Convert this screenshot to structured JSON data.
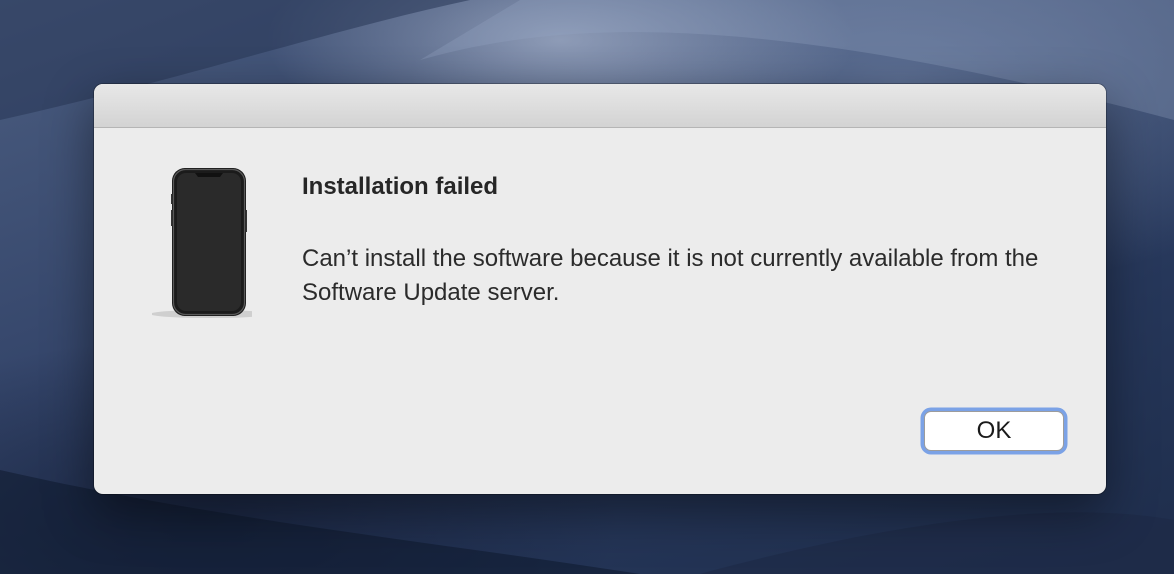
{
  "dialog": {
    "title": "Installation failed",
    "message": "Can’t install the software because it is not currently available from the Software Update server.",
    "icon": "iphone-device-icon",
    "ok_label": "OK"
  },
  "colors": {
    "focus_ring": "#7ba2e6",
    "dialog_background": "#ececec",
    "desktop": "#34456a"
  }
}
